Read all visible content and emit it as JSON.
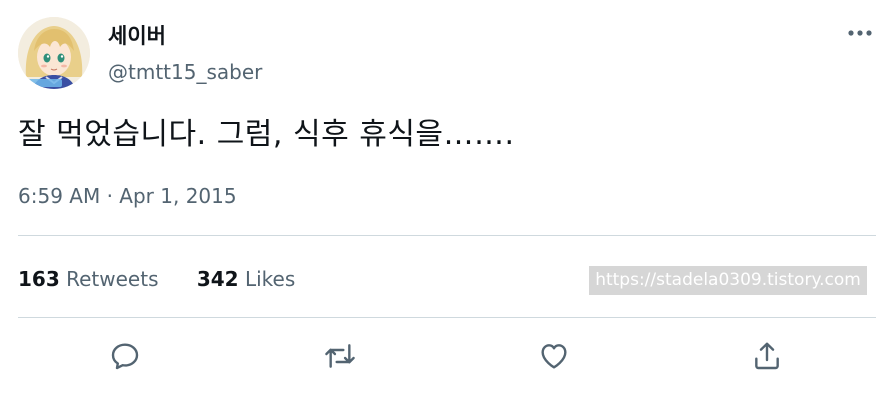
{
  "tweet": {
    "author": {
      "display_name": "세이버",
      "handle": "@tmtt15_saber",
      "avatar_icon": "anime-character-avatar"
    },
    "text": "잘 먹었습니다. 그럼, 식후 휴식을…….",
    "time": "6:59 AM",
    "separator": " · ",
    "date": "Apr 1, 2015",
    "stats": {
      "retweets_count": "163",
      "retweets_label": "Retweets",
      "likes_count": "342",
      "likes_label": "Likes"
    },
    "watermark": "https://stadela0309.tistory.com",
    "more_icon": "more-dots-icon",
    "actions": [
      {
        "name": "reply",
        "icon": "reply-icon"
      },
      {
        "name": "retweet",
        "icon": "retweet-icon"
      },
      {
        "name": "like",
        "icon": "heart-icon"
      },
      {
        "name": "share",
        "icon": "share-icon"
      }
    ]
  },
  "colors": {
    "primary_text": "#0f1419",
    "secondary_text": "#536471",
    "divider": "#cfd9de",
    "watermark_bg": "#d6d6d6"
  }
}
